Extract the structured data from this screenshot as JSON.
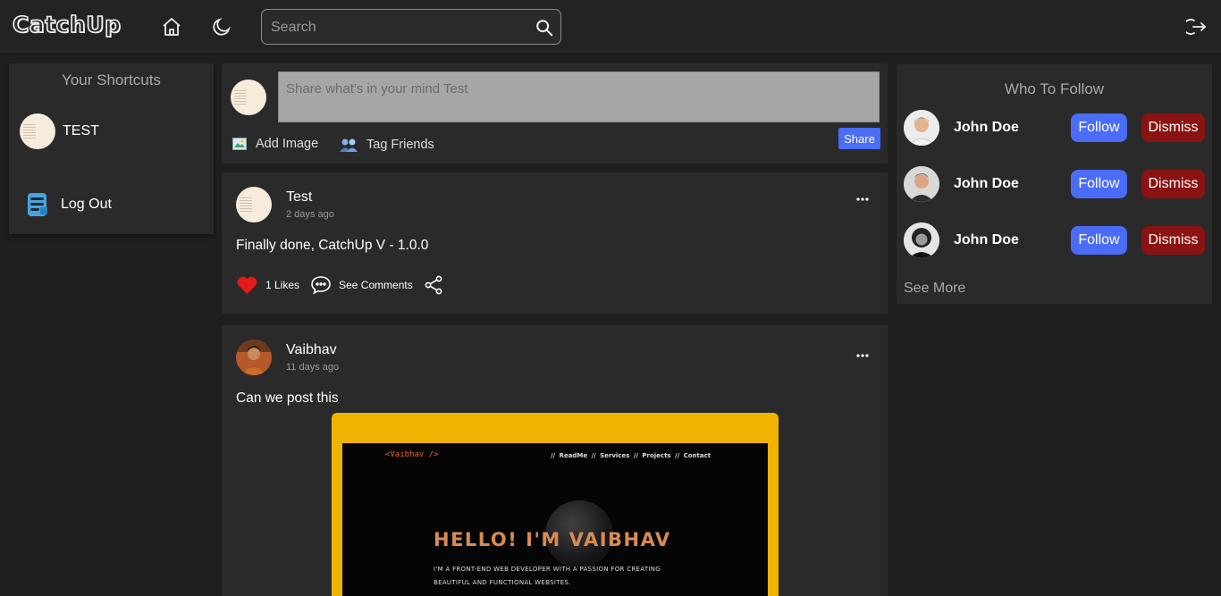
{
  "header": {
    "logo": "CatchUp",
    "search_placeholder": "Search"
  },
  "shortcuts": {
    "title": "Your Shortcuts",
    "items": [
      {
        "label": "TEST",
        "icon": "user-avatar"
      },
      {
        "label": "Log Out",
        "icon": "logout-icon"
      }
    ]
  },
  "composer": {
    "placeholder": "Share what's in your mind Test",
    "add_image": "Add Image",
    "tag_friends": "Tag Friends",
    "share": "Share"
  },
  "posts": [
    {
      "author": "Test",
      "time": "2 days ago",
      "text": "Finally done, CatchUp V - 1.0.0",
      "likes": "1 Likes",
      "comments": "See Comments"
    },
    {
      "author": "Vaibhav",
      "time": "11 days ago",
      "text": "Can we post this",
      "image": {
        "brand": "<Vaibhav />",
        "nav": "// ReadMe // Services // Projects // Contact",
        "headline": "HELLO! I'M VAIBHAV",
        "bio_line1": "I'M A FRONT-END WEB DEVELOPER WITH A PASSION FOR CREATING",
        "bio_line2": "BEAUTIFUL AND FUNCTIONAL WEBSITES."
      }
    }
  ],
  "who_to_follow": {
    "title": "Who To Follow",
    "people": [
      {
        "name": "John Doe",
        "follow": "Follow",
        "dismiss": "Dismiss"
      },
      {
        "name": "John Doe",
        "follow": "Follow",
        "dismiss": "Dismiss"
      },
      {
        "name": "John Doe",
        "follow": "Follow",
        "dismiss": "Dismiss"
      }
    ],
    "see_more": "See More"
  },
  "colors": {
    "background": "#1f1f20",
    "card": "#2a2a2b",
    "follow": "#4a6cf7",
    "dismiss": "#8a1212",
    "like": "#e21b1b"
  }
}
